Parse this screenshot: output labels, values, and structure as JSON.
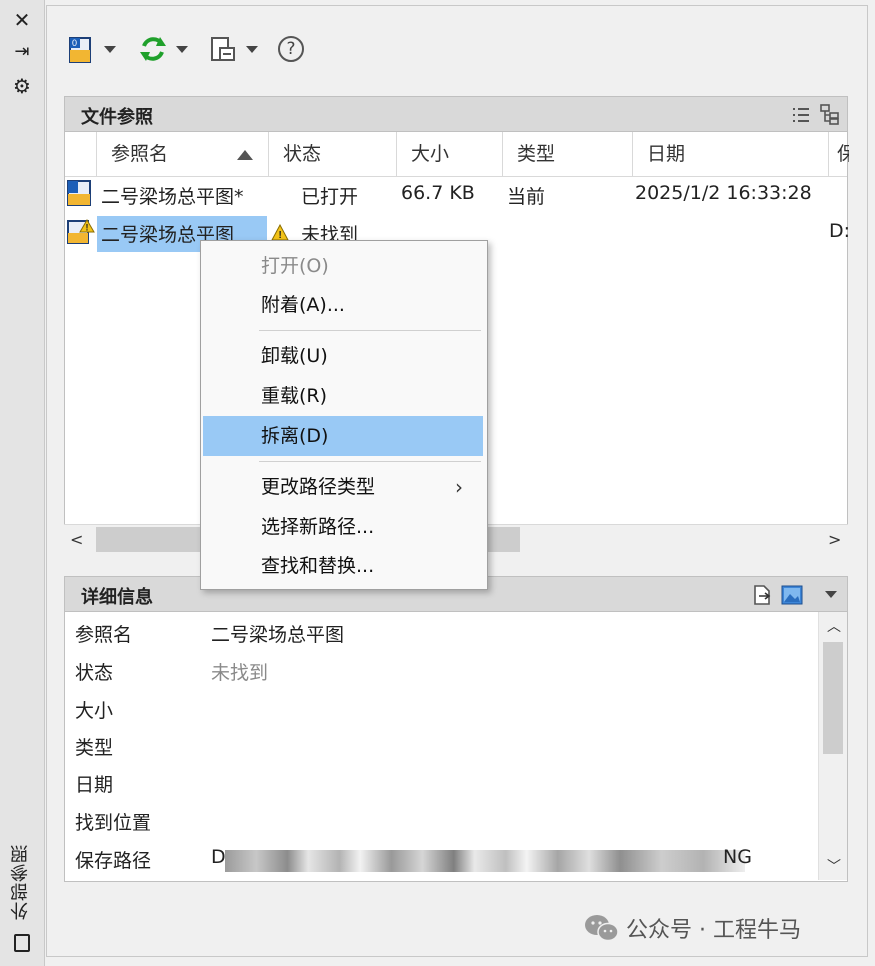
{
  "strip": {
    "title": "外部参照",
    "close_glyph": "✕",
    "pin_glyph": "⇥",
    "settings_glyph": "⚙"
  },
  "toolbar": {
    "help_glyph": "?"
  },
  "file_refs": {
    "section_title": "文件参照",
    "columns": [
      "参照名",
      "状态",
      "大小",
      "类型",
      "日期",
      "保"
    ],
    "rows": [
      {
        "name": "二号梁场总平图*",
        "status": "已打开",
        "size": "66.7 KB",
        "type": "当前",
        "date": "2025/1/2 16:33:28",
        "extra": ""
      },
      {
        "name": "二号梁场总平图",
        "status": "未找到",
        "size": "",
        "type": "",
        "date": "",
        "extra": "D:"
      }
    ]
  },
  "context_menu": {
    "items": [
      {
        "label": "打开(O)",
        "disabled": true
      },
      {
        "label": "附着(A)..."
      },
      {
        "label": "卸载(U)"
      },
      {
        "label": "重载(R)"
      },
      {
        "label": "拆离(D)",
        "highlighted": true
      },
      {
        "label": "更改路径类型",
        "submenu": true
      },
      {
        "label": "选择新路径..."
      },
      {
        "label": "查找和替换..."
      }
    ],
    "submenu_glyph": "›"
  },
  "details": {
    "section_title": "详细信息",
    "labels": [
      "参照名",
      "状态",
      "大小",
      "类型",
      "日期",
      "找到位置",
      "保存路径"
    ],
    "values": {
      "ref_name": "二号梁场总平图",
      "status": "未找到",
      "save_path_start": "D",
      "save_path_end": "NG"
    }
  },
  "watermark": {
    "text": "公众号 · 工程牛马"
  },
  "colors": {
    "selection": "#99c9f5",
    "refresh_green": "#1fa02b",
    "warning_yellow": "#f3c318"
  }
}
